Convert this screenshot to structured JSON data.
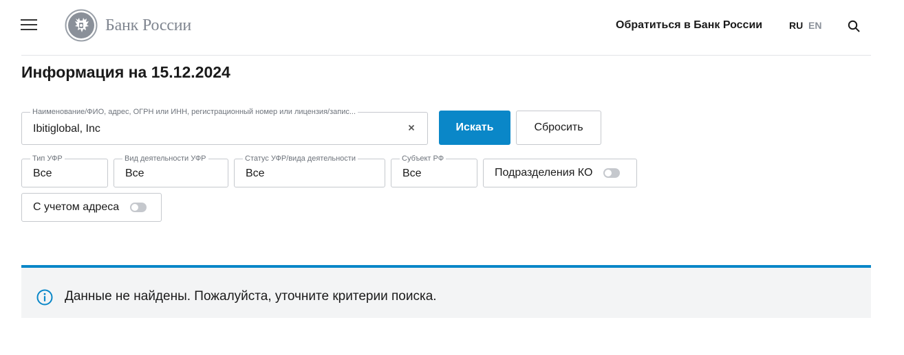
{
  "header": {
    "logo_text": "Банк России",
    "contact_link": "Обратиться в Банк России",
    "lang_ru": "RU",
    "lang_en": "EN"
  },
  "page": {
    "title": "Информация на 15.12.2024"
  },
  "search": {
    "label": "Наименование/ФИО, адрес, ОГРН или ИНН, регистрационный номер или лицензия/запис...",
    "value": "Ibitiglobal, Inc",
    "submit_label": "Искать",
    "reset_label": "Сбросить"
  },
  "filters": [
    {
      "label": "Тип УФР",
      "value": "Все"
    },
    {
      "label": "Вид деятельности УФР",
      "value": "Все"
    },
    {
      "label": "Статус УФР/вида деятельности",
      "value": "Все"
    },
    {
      "label": "Субъект РФ",
      "value": "Все"
    }
  ],
  "toggles": {
    "ko_divisions": {
      "label": "Подразделения КО",
      "on": false
    },
    "address": {
      "label": "С учетом адреса",
      "on": false
    }
  },
  "notice": {
    "text": "Данные не найдены. Пожалуйста, уточните критерии поиска."
  },
  "colors": {
    "accent": "#0a87c8",
    "logo_gray": "#808690",
    "border": "#c5c8cd",
    "notice_bg": "#f3f4f5"
  },
  "icons": {
    "menu": "hamburger-icon",
    "logo": "double-headed-eagle-emblem",
    "search": "search-icon",
    "clear": "close-icon",
    "info": "info-icon"
  }
}
